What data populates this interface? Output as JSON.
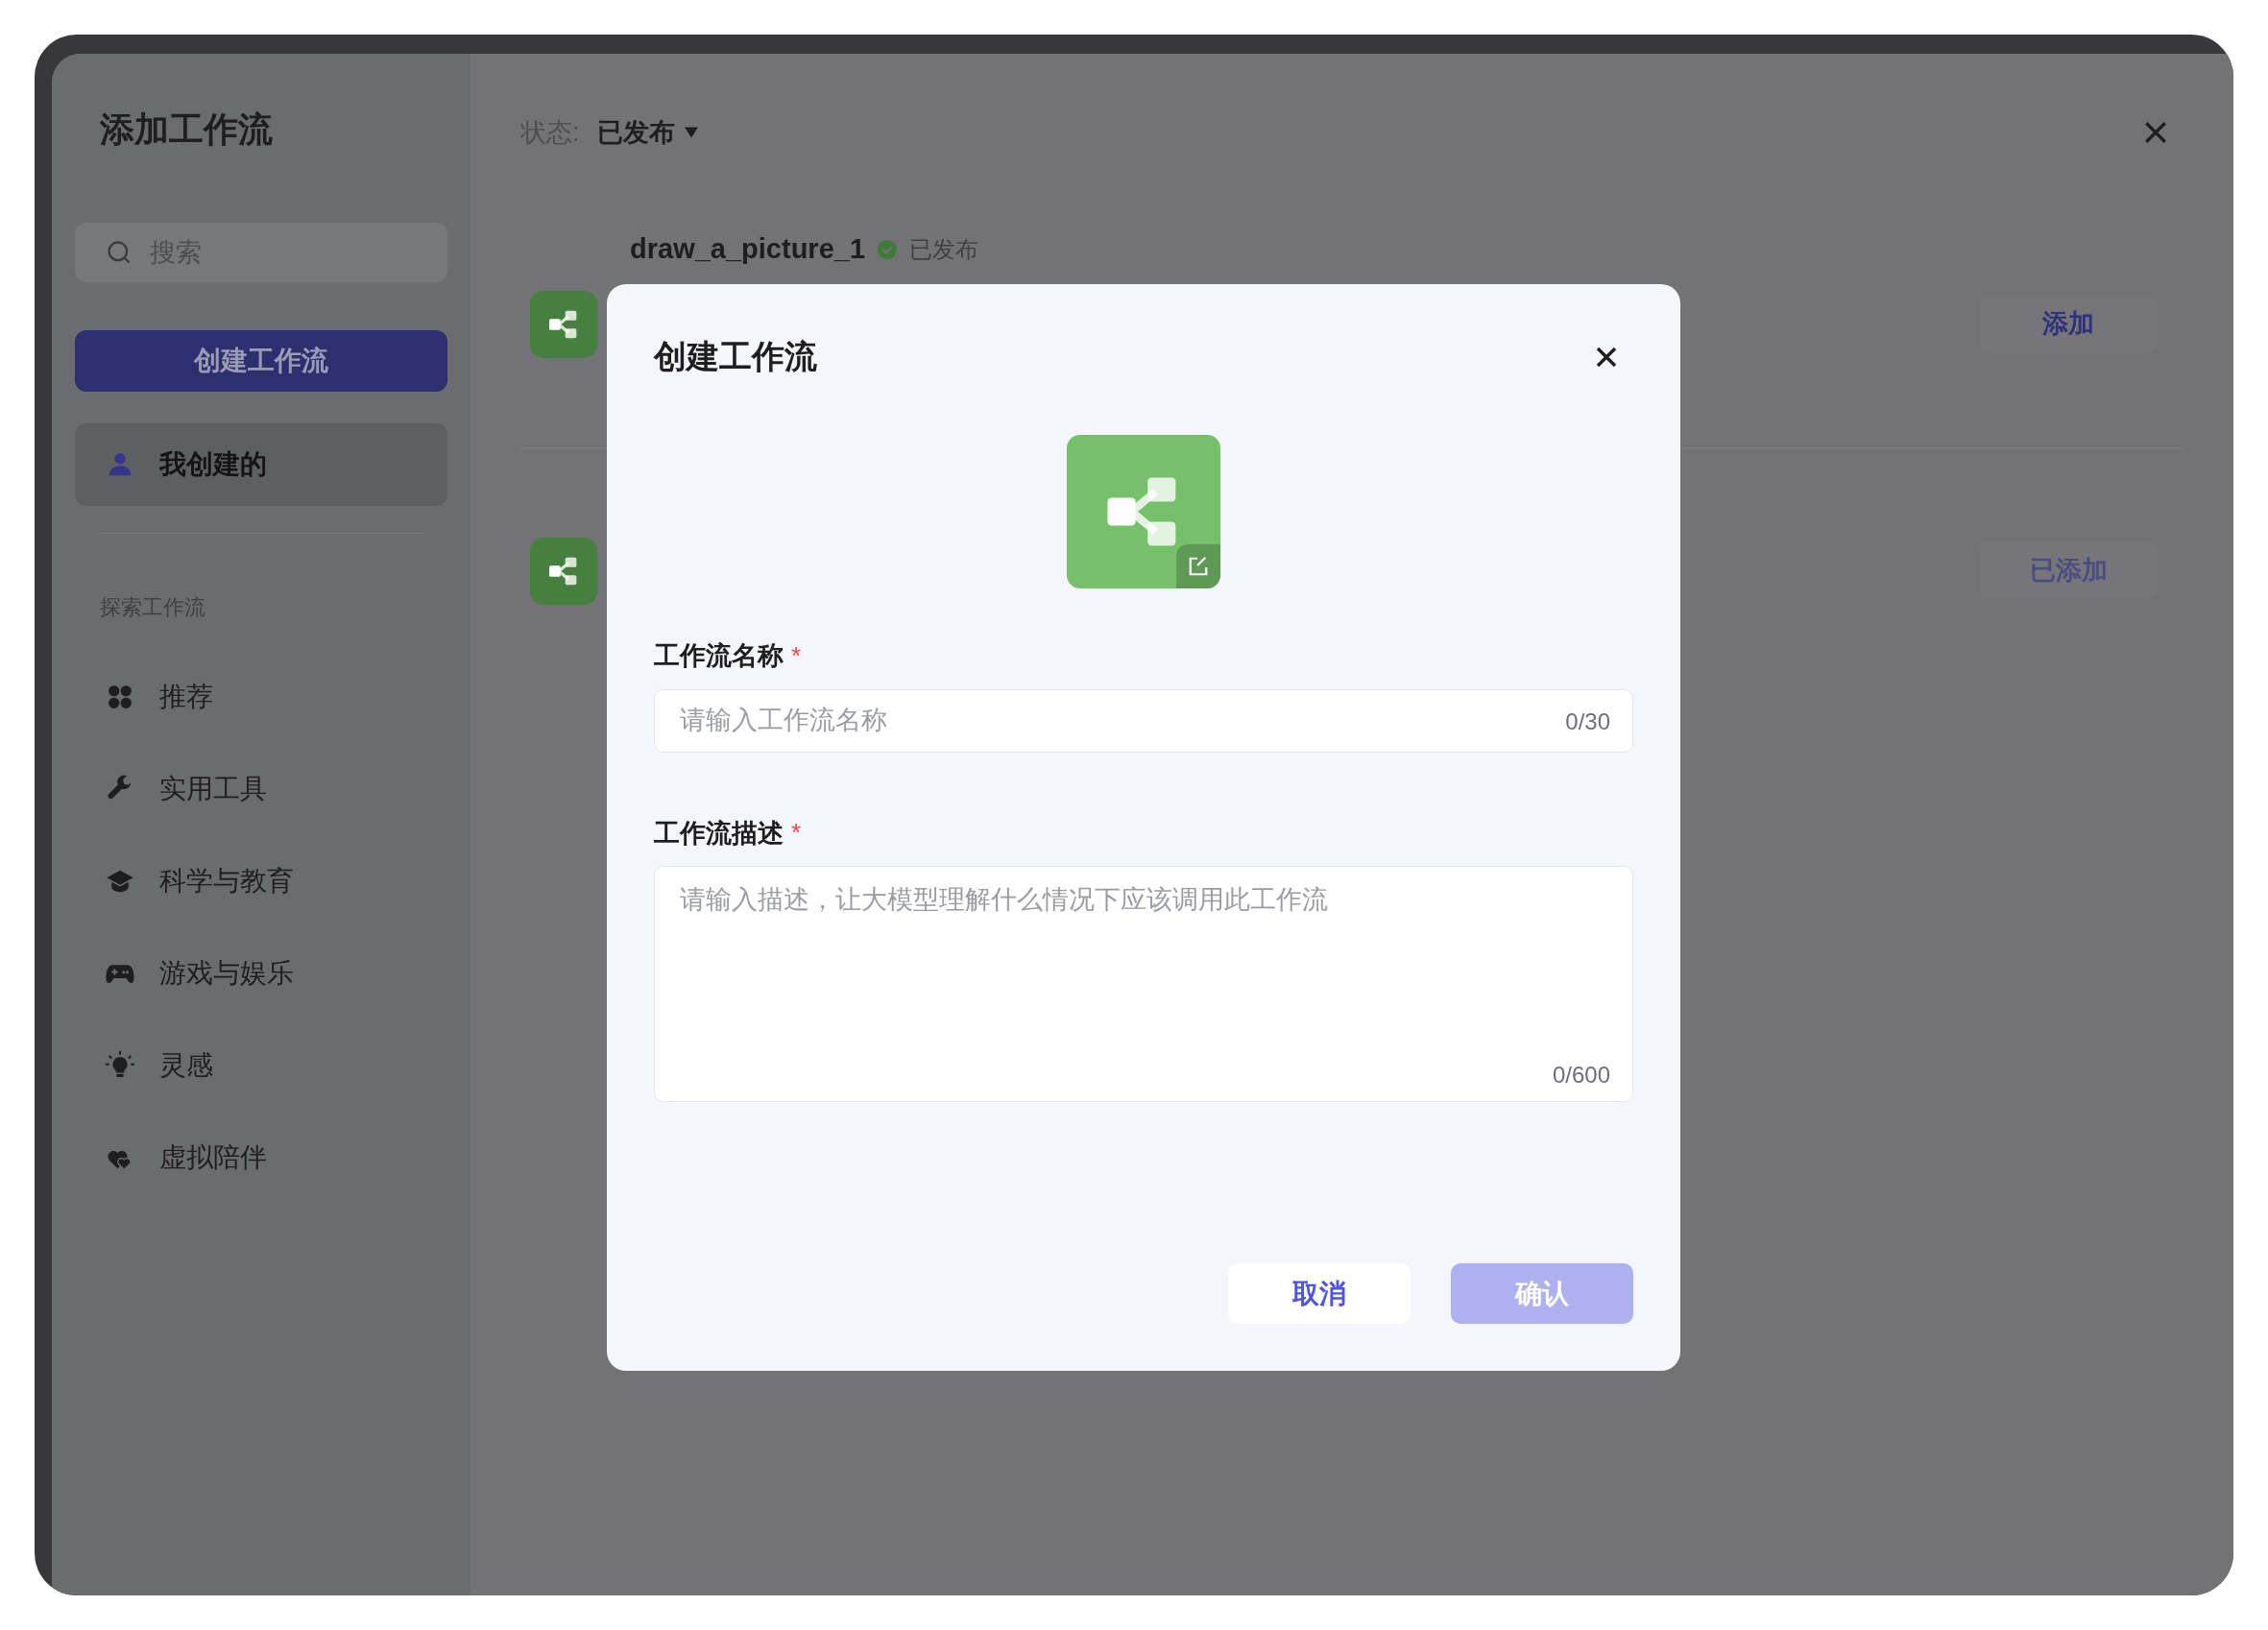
{
  "sidebar": {
    "title": "添加工作流",
    "search": {
      "placeholder": "搜索"
    },
    "create_button": "创建工作流",
    "my_items": [
      {
        "label": "我创建的",
        "selected": true
      }
    ],
    "section_title": "探索工作流",
    "categories": [
      {
        "label": "推荐",
        "selected": false
      },
      {
        "label": "实用工具",
        "selected": false
      },
      {
        "label": "科学与教育",
        "selected": false
      },
      {
        "label": "游戏与娱乐",
        "selected": false
      },
      {
        "label": "灵感",
        "selected": false
      },
      {
        "label": "虚拟陪伴",
        "selected": false
      }
    ]
  },
  "main": {
    "filter_label": "状态:",
    "filter_value": "已发布",
    "workflows": [
      {
        "name": "draw_a_picture_1",
        "status": "已发布",
        "button": "添加",
        "disabled": false
      },
      {
        "button": "已添加",
        "disabled": true
      }
    ]
  },
  "dialog": {
    "title": "创建工作流",
    "fields": [
      {
        "kind": "input",
        "label": "工作流名称",
        "required_mark": "*",
        "placeholder": "请输入工作流名称",
        "counter": "0/30"
      },
      {
        "kind": "textarea",
        "label": "工作流描述",
        "required_mark": "*",
        "placeholder": "请输入描述，让大模型理解什么情况下应该调用此工作流",
        "counter": "0/600"
      }
    ],
    "buttons": [
      {
        "label": "取消",
        "kind": "secondary",
        "disabled": false
      },
      {
        "label": "确认",
        "kind": "primary",
        "disabled": true
      }
    ]
  }
}
